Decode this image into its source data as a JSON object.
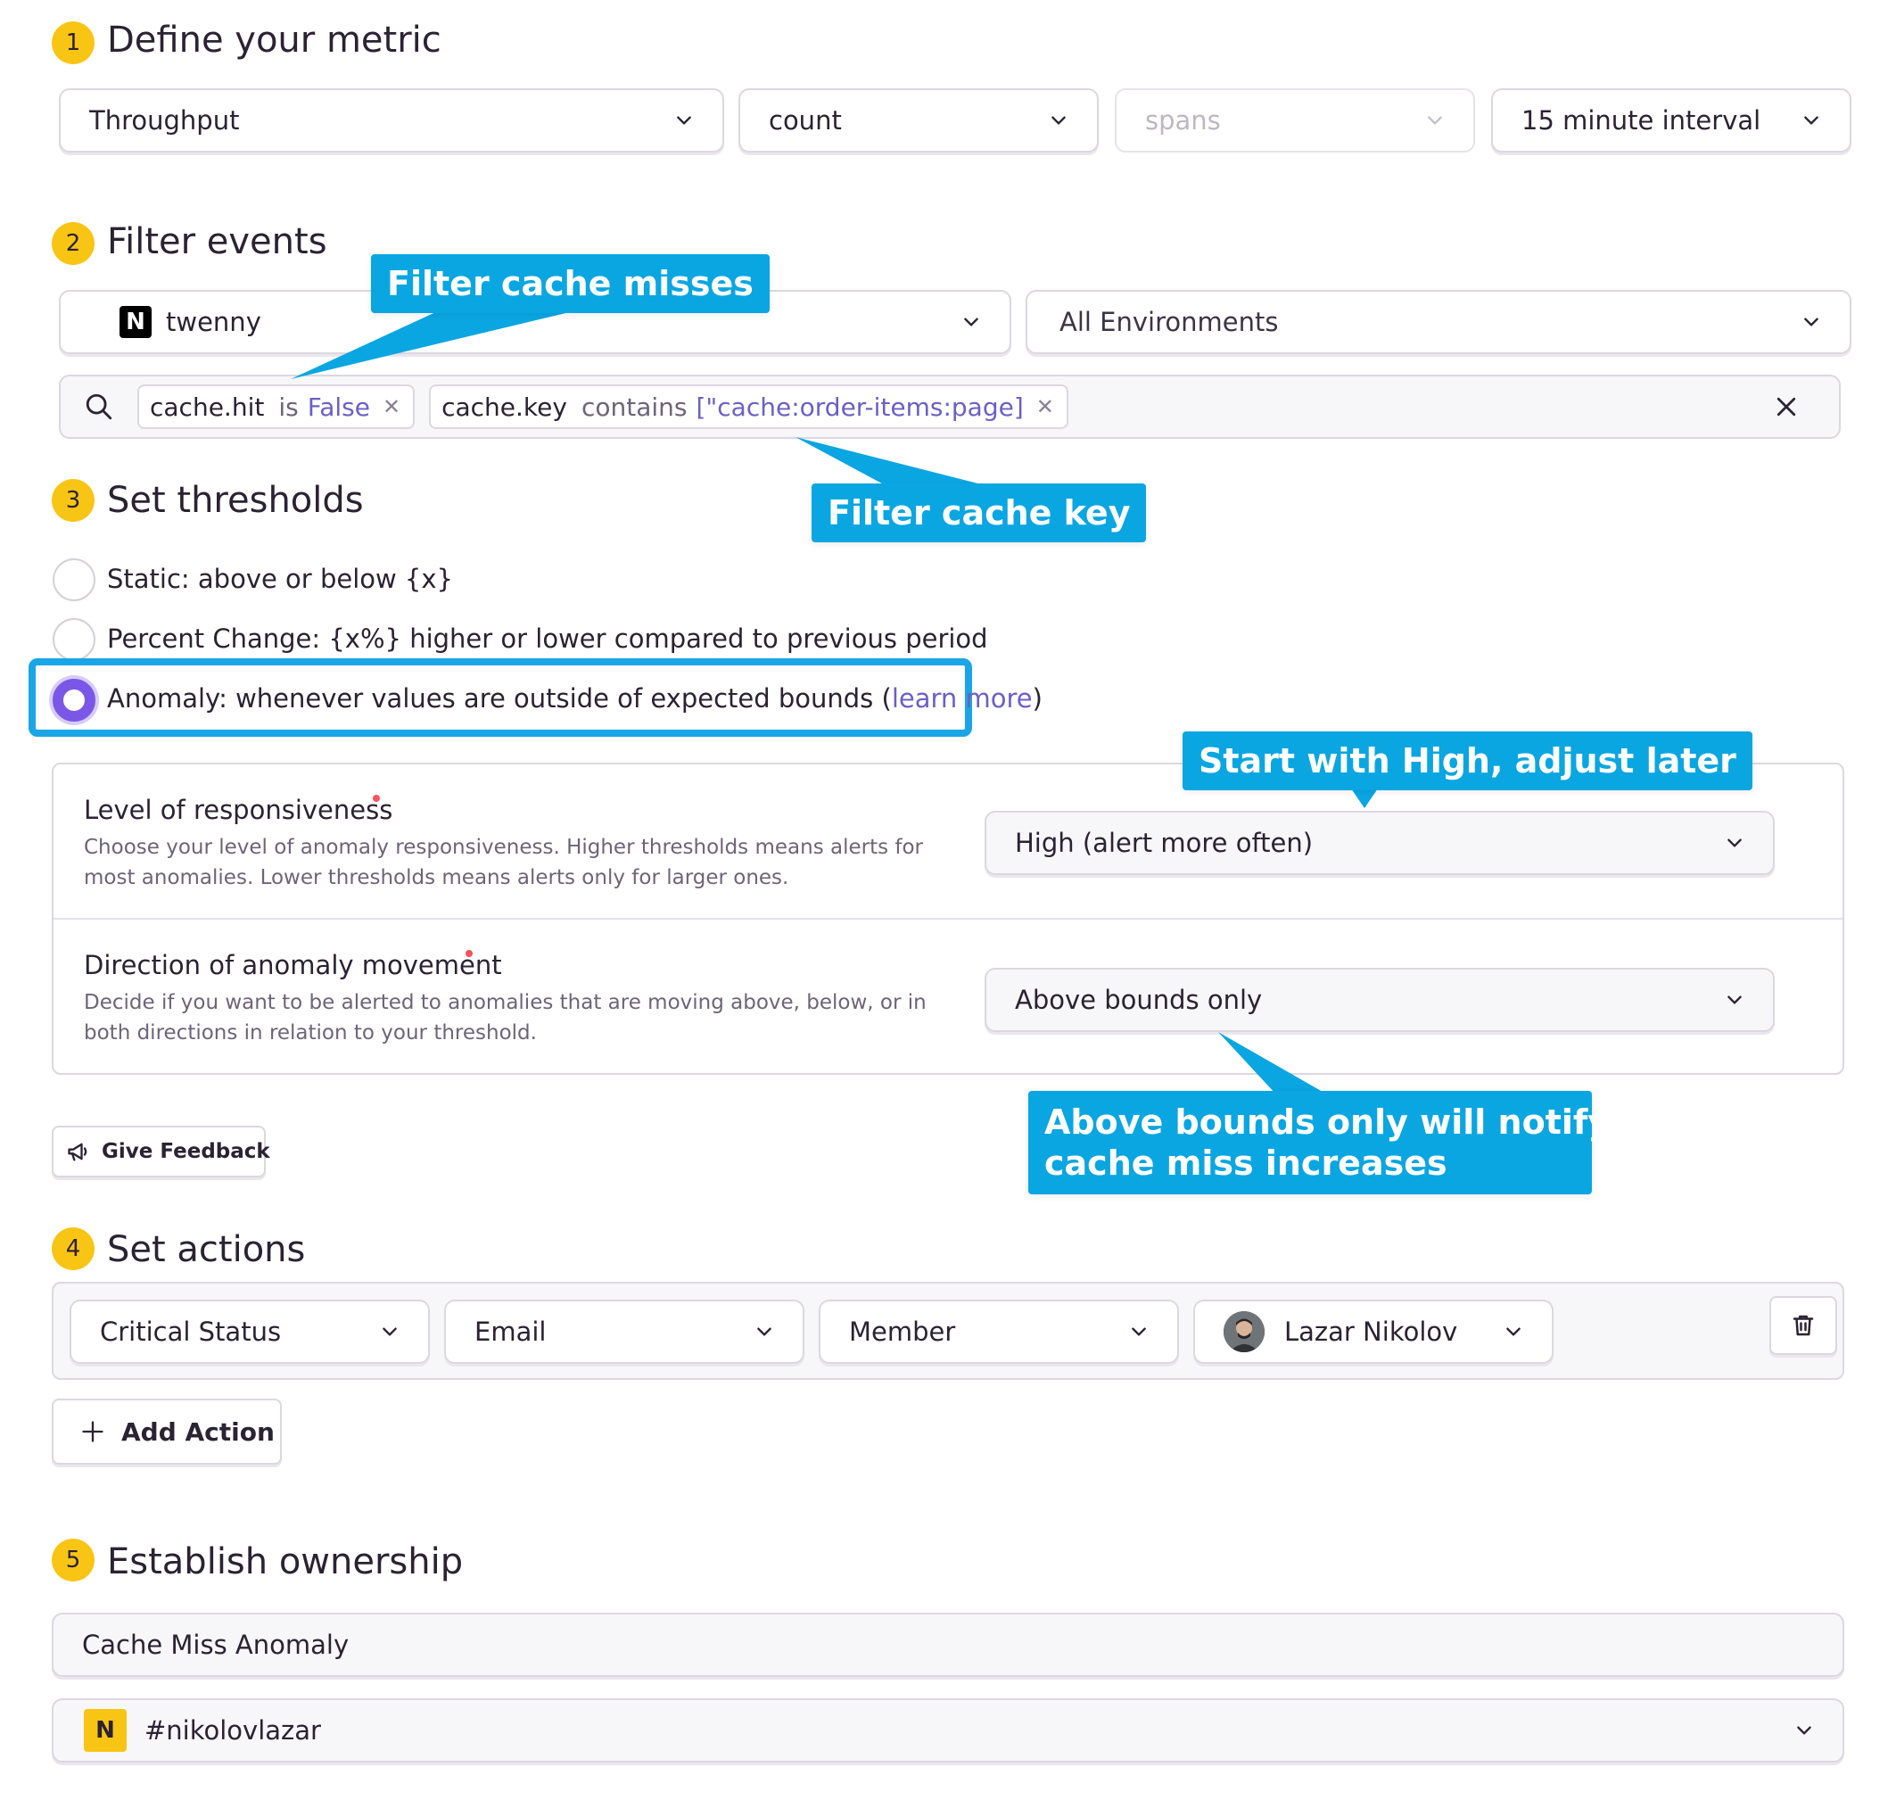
{
  "steps": [
    {
      "number": "1",
      "title": "Define your metric"
    },
    {
      "number": "2",
      "title": "Filter events"
    },
    {
      "number": "3",
      "title": "Set thresholds"
    },
    {
      "number": "4",
      "title": "Set actions"
    },
    {
      "number": "5",
      "title": "Establish ownership"
    }
  ],
  "metric": {
    "aggregate": "Throughput",
    "function": "count",
    "dataset": "spans",
    "interval": "15 minute interval"
  },
  "filters": {
    "project": "twenny",
    "project_icon": "N",
    "environment": "All Environments",
    "tokens": [
      {
        "key": "cache.hit",
        "op": "is",
        "value": "False"
      },
      {
        "key": "cache.key",
        "op": "contains",
        "value": "[\"cache:order-items:page]"
      }
    ]
  },
  "thresholds": {
    "options": [
      {
        "label": "Static: above or below {x}",
        "selected": false
      },
      {
        "label": "Percent Change: {x%} higher or lower compared to previous period",
        "selected": false
      },
      {
        "label_prefix": "Anomaly: whenever values are outside of expected bounds (",
        "link": "learn more",
        "label_suffix": ")",
        "selected": true
      }
    ],
    "responsiveness": {
      "title": "Level of responsiveness",
      "help": "Choose your level of anomaly responsiveness. Higher thresholds means alerts for most anomalies. Lower thresholds means alerts only for larger ones.",
      "value": "High (alert more often)"
    },
    "direction": {
      "title": "Direction of anomaly movement",
      "help": "Decide if you want to be alerted to anomalies that are moving above, below, or in both directions in relation to your threshold.",
      "value": "Above bounds only"
    },
    "feedback_label": "Give Feedback"
  },
  "actions": {
    "trigger": "Critical Status",
    "channel": "Email",
    "target_type": "Member",
    "target": "Lazar Nikolov",
    "add_label": "Add Action"
  },
  "ownership": {
    "rule_name": "Cache Miss Anomaly",
    "team_badge": "N",
    "team": "#nikolovlazar"
  },
  "callouts": {
    "filter_misses": "Filter cache misses",
    "filter_key": "Filter cache key",
    "start_high": "Start with High, adjust later",
    "above_bounds_line1": "Above bounds only will notify on",
    "above_bounds_line2": "cache miss increases"
  },
  "colors": {
    "step_badge": "#f9c514",
    "accent": "#7b57e8",
    "link": "#6c5fc7",
    "callout": "#0aa6e2",
    "required": "#f55459"
  }
}
